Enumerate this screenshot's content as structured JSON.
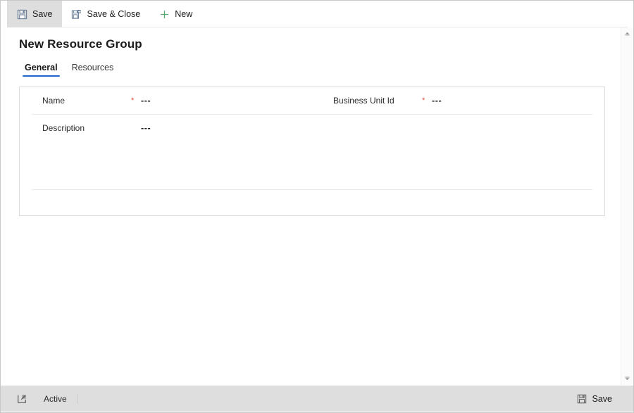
{
  "commandbar": {
    "buttons": [
      {
        "label": "Save",
        "icon": "save-floppy-icon",
        "active": true
      },
      {
        "label": "Save & Close",
        "icon": "save-and-close-icon",
        "active": false
      },
      {
        "label": "New",
        "icon": "plus-icon",
        "active": false
      }
    ]
  },
  "page": {
    "title": "New Resource Group"
  },
  "tabs": [
    {
      "label": "General",
      "selected": true
    },
    {
      "label": "Resources",
      "selected": false
    }
  ],
  "form": {
    "fields": {
      "name": {
        "label": "Name",
        "required": true,
        "required_marker": "*",
        "value": "---"
      },
      "business_unit_id": {
        "label": "Business Unit Id",
        "required": true,
        "required_marker": "*",
        "value": "---"
      },
      "description": {
        "label": "Description",
        "required": false,
        "required_marker": "",
        "value": "---"
      }
    }
  },
  "statusbar": {
    "popout_icon": "pop-out-icon",
    "state": "Active",
    "save_label": "Save",
    "save_icon": "save-floppy-icon"
  },
  "scrollbar": {
    "up_icon": "scroll-up-arrow-icon",
    "down_icon": "scroll-down-arrow-icon"
  },
  "colors": {
    "accent": "#2266cc",
    "required": "#e04a3a",
    "new_plus": "#5aaa6e",
    "floppy": "#6b7f99",
    "statusbar_bg": "#dedede"
  }
}
